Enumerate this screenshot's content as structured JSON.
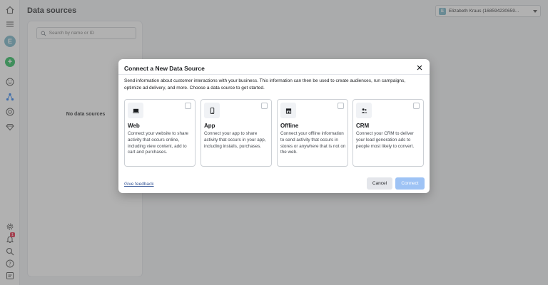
{
  "header": {
    "page_title": "Data sources",
    "account": {
      "avatar_letter": "E",
      "name": "Elizabeth Kraus (168594230659..."
    }
  },
  "rail": {
    "avatar_letter": "E",
    "notification_count": "1",
    "icons": [
      "home-icon",
      "menu-icon",
      "add-icon",
      "smiley-icon",
      "nodes-icon",
      "history-icon",
      "diamond-icon",
      "gear-icon",
      "bell-icon",
      "search-icon",
      "help-icon",
      "report-icon"
    ]
  },
  "left_panel": {
    "search_placeholder": "Search by name or ID",
    "empty_text": "No data sources"
  },
  "modal": {
    "title": "Connect a New Data Source",
    "description": "Send information about customer interactions with your business. This information can then be used to create audiences, run campaigns, optimize ad delivery, and more. Choose a data source to get started.",
    "cards": [
      {
        "icon": "monitor-icon",
        "title": "Web",
        "description": "Connect your website to share activity that occurs online, including view content, add to cart and purchases."
      },
      {
        "icon": "phone-icon",
        "title": "App",
        "description": "Connect your app to share activity that occurs in your app, including installs, purchases."
      },
      {
        "icon": "store-icon",
        "title": "Offline",
        "description": "Connect your offline information to send activity that occurs in stores or anywhere that is not on the web."
      },
      {
        "icon": "people-icon",
        "title": "CRM",
        "description": "Connect your CRM to deliver your lead generation ads to people most likely to convert."
      }
    ],
    "feedback_link": "Give feedback",
    "cancel_label": "Cancel",
    "connect_label": "Connect"
  },
  "colors": {
    "overlay": "#7a7a7a",
    "primary_disabled": "#9ec3f5",
    "add_green": "#1db954",
    "avatar": "#6fb1c4",
    "badge": "#e41e3f"
  }
}
